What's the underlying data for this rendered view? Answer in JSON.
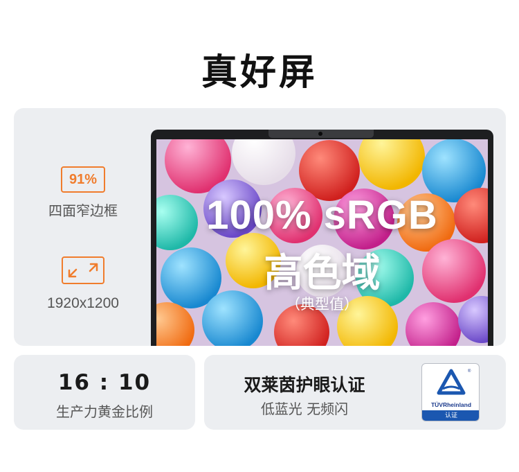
{
  "title": "真好屏",
  "features": {
    "bezel_badge": "91%",
    "bezel_label": "四面窄边框",
    "resolution_icon": "expand-arrows-icon",
    "resolution_label": "1920x1200"
  },
  "screen": {
    "line1": "100% sRGB",
    "line2": "高色域",
    "line3": "（典型值）"
  },
  "ratio": {
    "value": "16 : 10",
    "label": "生产力黄金比例"
  },
  "eye_care": {
    "title": "双莱茵护眼认证",
    "subtitle": "低蓝光 无频闪",
    "logo_brand": "TÜVRheinland",
    "logo_cert": "认证"
  },
  "colors": {
    "accent": "#f07c2c",
    "panel_bg": "#eceef1",
    "tuv_blue": "#1b57b0"
  }
}
